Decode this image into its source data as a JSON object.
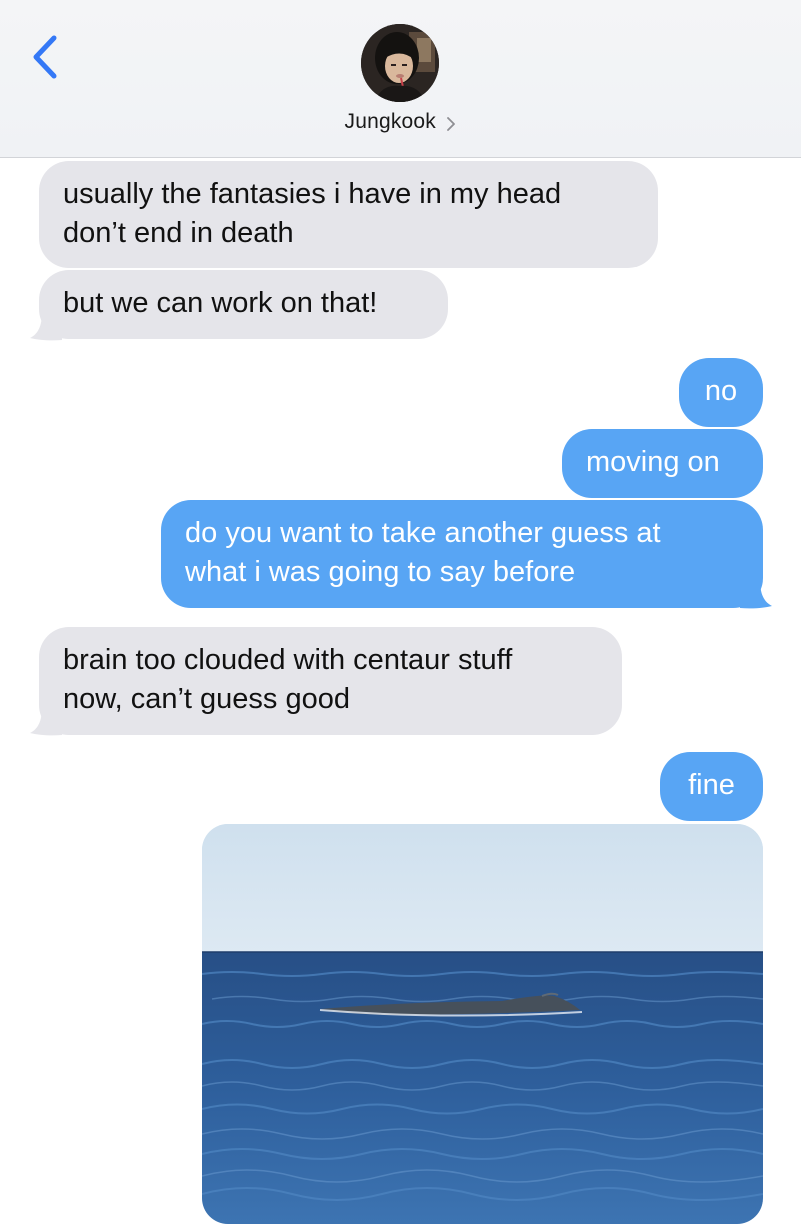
{
  "header": {
    "contact_name": "Jungkook",
    "back_icon": "chevron-left-icon",
    "detail_icon": "chevron-right-icon",
    "avatar_icon": "contact-avatar"
  },
  "colors": {
    "incoming_bubble": "#e5e5ea",
    "outgoing_bubble": "#58a5f4",
    "accent": "#3478f6"
  },
  "messages": [
    {
      "direction": "incoming",
      "lines": [
        "usually the fantasies i have in my head",
        "don’t end in death"
      ]
    },
    {
      "direction": "incoming",
      "lines": [
        "but we can work on that!"
      ]
    },
    {
      "direction": "outgoing",
      "lines": [
        "no"
      ]
    },
    {
      "direction": "outgoing",
      "lines": [
        "moving on"
      ]
    },
    {
      "direction": "outgoing",
      "lines": [
        "do you want to take another guess at",
        "what i was going to say before"
      ]
    },
    {
      "direction": "incoming",
      "lines": [
        "brain too clouded with centaur stuff",
        "now, can’t guess good"
      ]
    },
    {
      "direction": "outgoing",
      "lines": [
        "fine"
      ]
    },
    {
      "direction": "outgoing",
      "type": "image",
      "image_description": "ocean-whale-photo"
    }
  ]
}
